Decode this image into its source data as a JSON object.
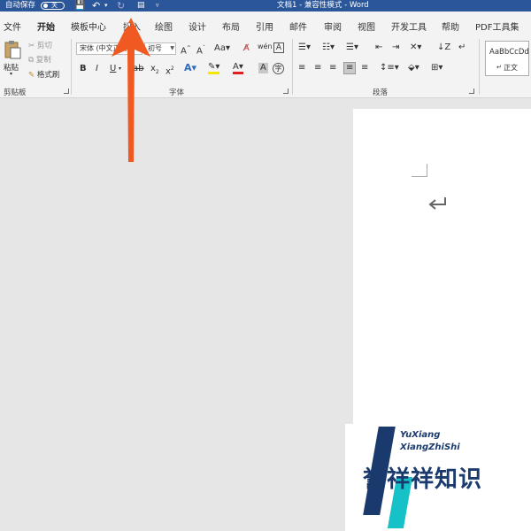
{
  "titlebar": {
    "autosave": "自动保存",
    "toggle": "关",
    "title": "文档1 - 兼容性模式 - Word"
  },
  "tabs": [
    "文件",
    "开始",
    "模板中心",
    "插入",
    "绘图",
    "设计",
    "布局",
    "引用",
    "邮件",
    "审阅",
    "视图",
    "开发工具",
    "帮助",
    "PDF工具集"
  ],
  "clipboard": {
    "paste": "粘贴",
    "cut": "剪切",
    "copy": "复制",
    "format_painter": "格式刷",
    "group_label": "剪贴板"
  },
  "font": {
    "name": "宋体 (中文正文)",
    "size": "初号",
    "group_label": "字体"
  },
  "paragraph": {
    "group_label": "段落"
  },
  "styles": {
    "preview": "AaBbCcDd",
    "name": "正文"
  },
  "watermark": {
    "line1": "YuXiang",
    "line2": "XiangZhiShi",
    "brand": "誉祥祥知识"
  }
}
